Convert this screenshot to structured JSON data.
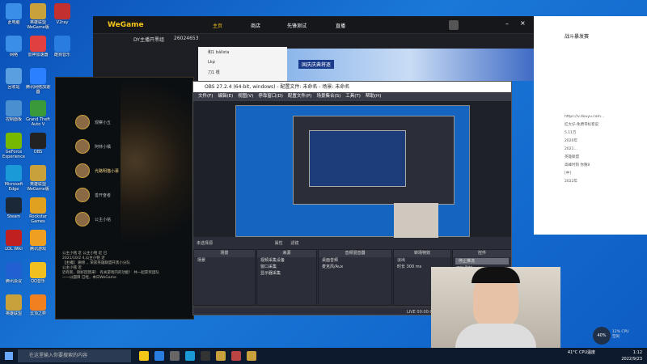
{
  "desktop_icons": [
    {
      "label": "此电脑",
      "color": "#3a8ee6"
    },
    {
      "label": "英雄联盟WeGame版",
      "color": "#c8a03c"
    },
    {
      "label": "V2ray",
      "color": "#c23030"
    },
    {
      "label": "网络",
      "color": "#3a8ee6"
    },
    {
      "label": "雷神加速器",
      "color": "#e04040"
    },
    {
      "label": "酷狗音乐",
      "color": "#2a7de0"
    },
    {
      "label": "回收站",
      "color": "#5aa0e0"
    },
    {
      "label": "腾讯网络加速器",
      "color": "#2a80ff"
    },
    {
      "label": "控制面板",
      "color": "#4a90d0"
    },
    {
      "label": "Grand Theft Auto V",
      "color": "#3a9a3a"
    },
    {
      "label": "GeForce Experience",
      "color": "#76b900"
    },
    {
      "label": "OBS",
      "color": "#222"
    },
    {
      "label": "Microsoft Edge",
      "color": "#1a9ad6"
    },
    {
      "label": "英雄联盟WeGame版",
      "color": "#c8a03c"
    },
    {
      "label": "Steam",
      "color": "#1b2838"
    },
    {
      "label": "Rockstar Games Launcher",
      "color": "#e0a020"
    },
    {
      "label": "LOL Wiki",
      "color": "#c02020"
    },
    {
      "label": "腾讯游戏",
      "color": "#f0a020"
    },
    {
      "label": "腾讯会议",
      "color": "#2060d0"
    },
    {
      "label": "QQ音乐",
      "color": "#f0c020"
    },
    {
      "label": "英雄联盟",
      "color": "#c8a03c"
    },
    {
      "label": "云顶之弈",
      "color": "#f08020"
    }
  ],
  "wegame": {
    "logo": "WeGame",
    "user": "DY主播开黑组",
    "id": "26024653",
    "count": "15",
    "tabs": [
      "主页",
      "商店",
      "先锋测试",
      "直播"
    ],
    "list": [
      "和1 bálista",
      "Lkp",
      "刀1 根"
    ],
    "banner": "国庆庆典将逐"
  },
  "browser": {
    "title": "战斗暴发赛",
    "lines": [
      "https://v.douyu.com...",
      "扛大仔-免费带标客说",
      "5.11万",
      "2020年",
      "2021...",
      "英雄联盟 ",
      "高峰时刻 你猜8",
      "[中]",
      "2022年"
    ]
  },
  "lol": {
    "friends": [
      "观察小五",
      "阿林小橘",
      "光路明猫小慕",
      "善开奋者",
      "公主小铭"
    ],
    "chat": [
      "公主小铭 近 公主小铭 近 已",
      "2021/10/2 4,公主小铭 近",
      "【主播】 删修 ，荣获英雄联盟开黑小分队",
      "公主小铭 近",
      "近有新，刚好回馈来！ 有关游戏内的功能！ 共一起获奖团队一一以圆目 已经，本日WeGame"
    ]
  },
  "obs": {
    "title": "OBS 27.2.4 (64-bit, windows) - 配置文件: 未命名 - 场景: 未命名",
    "menu": [
      "文件(F)",
      "编辑(E)",
      "视图(V)",
      "停靠窗口(D)",
      "配置文件(P)",
      "场景集合(S)",
      "工具(T)",
      "帮助(H)"
    ],
    "toolbar": [
      "未选择源",
      "属性",
      "滤镜"
    ],
    "panels": [
      {
        "header": "场景",
        "rows": [
          "场景"
        ]
      },
      {
        "header": "来源",
        "rows": [
          "视频采集设备",
          "窗口采集",
          "显示器采集"
        ]
      },
      {
        "header": "音频混音器",
        "rows": [
          "桌面音频",
          "麦克风/Aux"
        ]
      },
      {
        "header": "转场特效",
        "rows": [
          "淡出",
          "时长 300 ms"
        ]
      },
      {
        "header": "控件",
        "rows": [
          "停止推流",
          "开始录制",
          "工作室模式",
          "设置",
          "退出"
        ]
      }
    ],
    "status": "LIVE 00:00:00  REC 00:00:00  CPU: 5.0%, 60.00 fps"
  },
  "taskbar": {
    "search": "在这里输入你要搜索的内容",
    "weather": "41°C CPU温度",
    "time": "1:12",
    "date": "2022/9/23",
    "battery": "40%",
    "cpu": "12% CPU空闲"
  }
}
